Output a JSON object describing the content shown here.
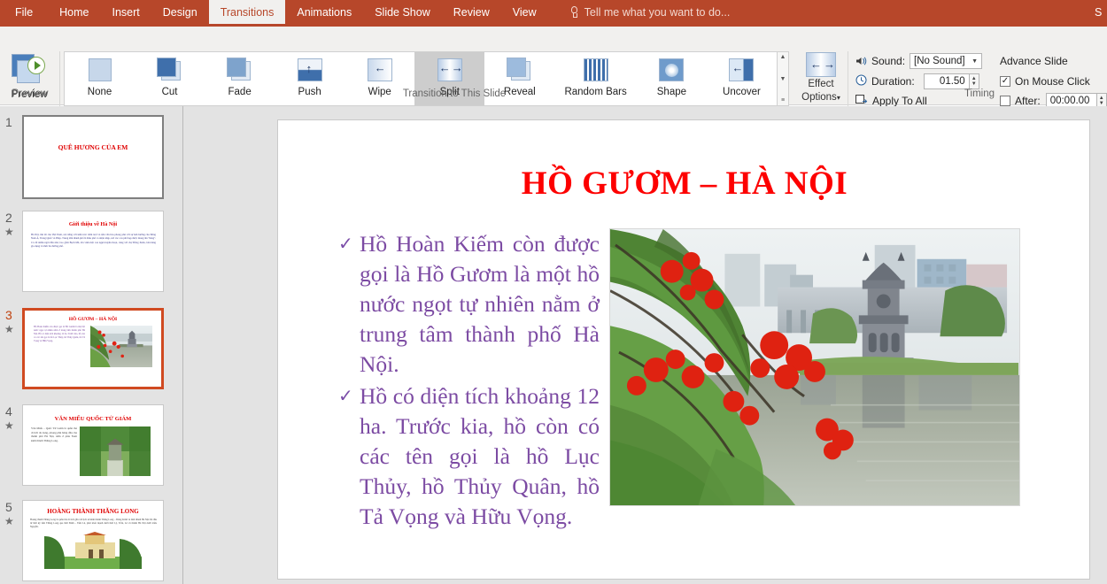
{
  "app": {
    "accent_color": "#b7472a",
    "ribbon_bg": "#f1f0ee",
    "title_text_color": "#ffffff"
  },
  "tabs": [
    {
      "label": "File",
      "active": false
    },
    {
      "label": "Home",
      "active": false
    },
    {
      "label": "Insert",
      "active": false
    },
    {
      "label": "Design",
      "active": false
    },
    {
      "label": "Transitions",
      "active": true
    },
    {
      "label": "Animations",
      "active": false
    },
    {
      "label": "Slide Show",
      "active": false
    },
    {
      "label": "Review",
      "active": false
    },
    {
      "label": "View",
      "active": false
    }
  ],
  "tellme": {
    "icon": "lightbulb-icon",
    "placeholder": "Tell me what you want to do..."
  },
  "tabbar_right_partial": "S",
  "ribbon": {
    "preview": {
      "button_label": "Preview",
      "group_label": "Preview",
      "icon": "preview-play-icon"
    },
    "gallery": {
      "group_label": "Transition to This Slide",
      "selected": "Split",
      "items": [
        {
          "label": "None",
          "icon": "transition-none-icon"
        },
        {
          "label": "Cut",
          "icon": "transition-cut-icon"
        },
        {
          "label": "Fade",
          "icon": "transition-fade-icon"
        },
        {
          "label": "Push",
          "icon": "transition-push-icon"
        },
        {
          "label": "Wipe",
          "icon": "transition-wipe-icon"
        },
        {
          "label": "Split",
          "icon": "transition-split-icon"
        },
        {
          "label": "Reveal",
          "icon": "transition-reveal-icon"
        },
        {
          "label": "Random Bars",
          "icon": "transition-random-bars-icon"
        },
        {
          "label": "Shape",
          "icon": "transition-shape-icon"
        },
        {
          "label": "Uncover",
          "icon": "transition-uncover-icon"
        }
      ],
      "scroll_up": "▲",
      "scroll_down": "▼",
      "scroll_more": "≡"
    },
    "effect_options": {
      "label_line1": "Effect",
      "label_line2": "Options",
      "dropdown_arrow": "▾",
      "icon": "effect-options-split-icon"
    },
    "timing": {
      "group_label": "Timing",
      "sound_label": "Sound:",
      "sound_value": "[No Sound]",
      "sound_icon": "speaker-icon",
      "duration_label": "Duration:",
      "duration_value": "01.50",
      "duration_icon": "clock-icon",
      "apply_to_all_label": "Apply To All",
      "apply_to_all_icon": "apply-to-all-icon",
      "advance_slide_label": "Advance Slide",
      "on_mouse_click_label": "On Mouse Click",
      "on_mouse_click_checked": true,
      "after_label": "After:",
      "after_checked": false,
      "after_value": "00:00.00",
      "checkmark": "✓"
    }
  },
  "slide_panel": {
    "selected_index": 3,
    "star_glyph": "★",
    "thumbnails": [
      {
        "number": "1",
        "has_star": false,
        "selected": false,
        "title": "QUÊ HƯƠNG CỦA EM",
        "body": "",
        "has_photo": false
      },
      {
        "number": "2",
        "has_star": true,
        "selected": false,
        "title": "Giới thiệu về Hà Nội",
        "body": "Hà Nội, thủ đô của Việt Nam, nổi tiếng với kiến trúc trăm tuổi và nền văn hóa phong phú với sự ảnh hưởng của Đông Nam Á, Trung Quốc và Pháp. Trung tâm thành phố là Khu phố cổ nhộn nhịp, nơi các con phố hẹp được mang tên \"hàng\". Có rất nhiều ngôi đền nhỏ, bao gồm Bạch Mã, tôn vinh một con ngựa huyền thoại, cùng với chợ Đồng Xuân, bán hàng gia dụng và thức ăn đường phố.",
        "has_photo": false
      },
      {
        "number": "3",
        "has_star": true,
        "selected": true,
        "title": "HỒ GƯƠM – HÀ NỘI",
        "body": "Hồ Hoàn Kiếm còn được gọi là Hồ Gươm là một hồ nước ngọt tự nhiên nằm ở trung tâm thành phố Hà Nội. Hồ có diện tích khoảng 12 ha. Trước kia, hồ còn có các tên gọi là hồ Lục Thủy, hồ Thủy Quân, hồ Tả Vọng và Hữu Vọng.",
        "has_photo": true,
        "photo": "hoan-kiem-lake-photo"
      },
      {
        "number": "4",
        "has_star": true,
        "selected": false,
        "title": "VĂN MIẾU QUỐC TỬ GIÁM",
        "body": "Văn Miếu – Quốc Tử Giám là quần thể di tích đa dạng, phong phú hàng đầu của thành phố Hà Nội, nằm ở phía Nam kinh thành Thăng Long.",
        "has_photo": true,
        "photo": "van-mieu-photo"
      },
      {
        "number": "5",
        "has_star": true,
        "selected": false,
        "title": "HOÀNG THÀNH THĂNG LONG",
        "body": "Hoàng thành Thăng Long là quần thể di tích gắn với lịch sử kinh thành Thăng Long – Đông Kinh và tỉnh thành Hà Nội bắt đầu từ thời kỳ tiền Thăng Long qua thời Đinh – Tiền Lê, phát triển mạnh dưới thời Lý, Trần, Lê và thành Hà Nội dưới triều Nguyễn.",
        "has_photo": true,
        "photo": "hoang-thanh-photo"
      }
    ]
  },
  "slide": {
    "title": "HỒ GƯƠM – HÀ NỘI",
    "title_color": "#fd0000",
    "body_color": "#7c4ba3",
    "bullet_glyph": "✓",
    "bullets": [
      "Hồ Hoàn Kiếm còn được gọi là Hồ Gươm là một hồ nước ngọt tự nhiên nằm ở trung tâm thành phố Hà Nội.",
      "Hồ có diện tích khoảng 12 ha. Trước kia, hồ còn có các tên gọi là hồ Lục Thủy, hồ Thủy Quân, hồ Tả Vọng và Hữu Vọng."
    ],
    "photo": {
      "name": "hoan-kiem-lake-turtle-tower-photo",
      "description": "Turtle Tower on Hoan Kiem Lake framed by red flame tree blossoms"
    }
  }
}
